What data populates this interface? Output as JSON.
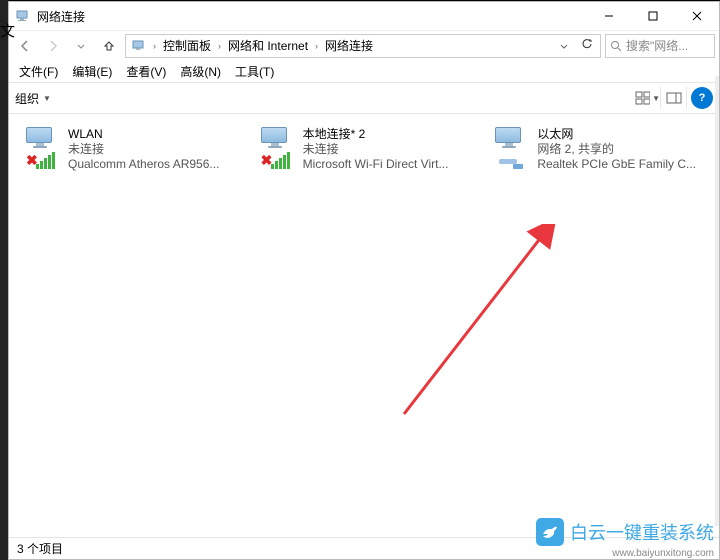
{
  "window": {
    "title": "网络连接"
  },
  "titlebar_buttons": {
    "min": "–",
    "max": "□",
    "close": "✕"
  },
  "breadcrumbs": {
    "root": "控制面板",
    "mid": "网络和 Internet",
    "leaf": "网络连接"
  },
  "search": {
    "placeholder": "搜索\"网络..."
  },
  "menus": {
    "file": "文件(F)",
    "edit": "编辑(E)",
    "view": "查看(V)",
    "advanced": "高级(N)",
    "tools": "工具(T)"
  },
  "toolbar": {
    "organize": "组织",
    "help": "?"
  },
  "connections": [
    {
      "name": "WLAN",
      "status": "未连接",
      "device": "Qualcomm Atheros AR956...",
      "type": "wifi-disabled"
    },
    {
      "name": "本地连接* 2",
      "status": "未连接",
      "device": "Microsoft Wi-Fi Direct Virt...",
      "type": "wifi-disabled"
    },
    {
      "name": "以太网",
      "status": "网络 2, 共享的",
      "device": "Realtek PCIe GbE Family C...",
      "type": "ethernet"
    }
  ],
  "statusbar": {
    "count": "3 个项目"
  },
  "watermark": {
    "text": "白云一键重装系统",
    "url": "www.baiyunxitong.com"
  },
  "colors": {
    "accent": "#0078d4",
    "arrow": "#e8383d",
    "brand": "#3fa9e6"
  }
}
